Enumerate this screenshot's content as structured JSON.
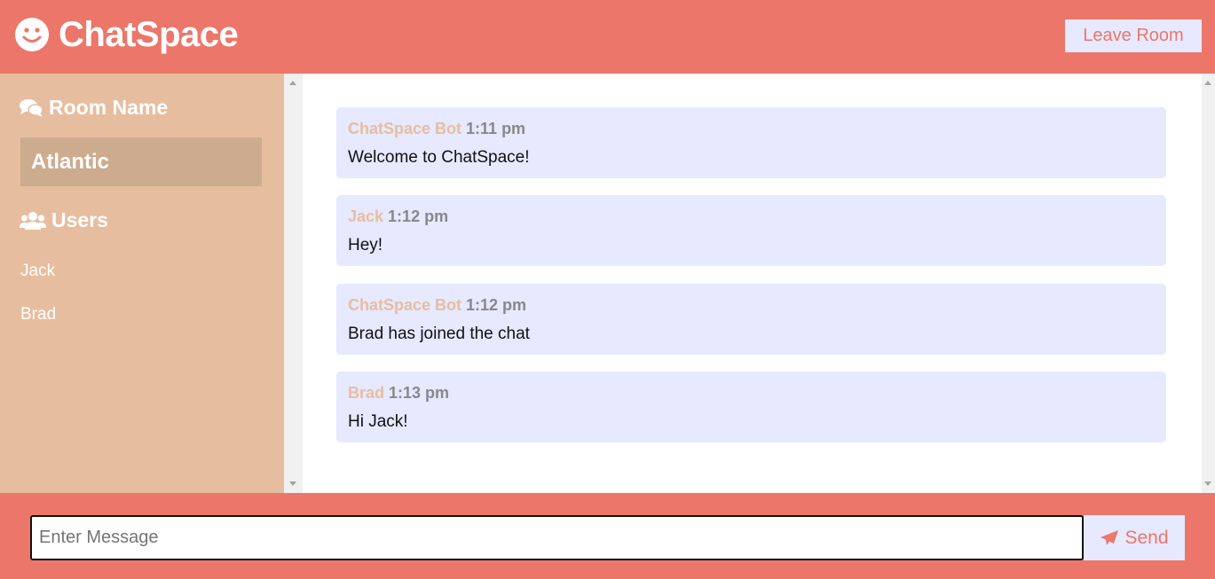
{
  "app": {
    "title": "ChatSpace",
    "leave_label": "Leave Room"
  },
  "sidebar": {
    "room_section_title": "Room Name",
    "room_name": "Atlantic",
    "users_section_title": "Users",
    "users": [
      "Jack",
      "Brad"
    ]
  },
  "messages": [
    {
      "author": "ChatSpace Bot",
      "time": "1:11 pm",
      "text": "Welcome to ChatSpace!"
    },
    {
      "author": "Jack",
      "time": "1:12 pm",
      "text": "Hey!"
    },
    {
      "author": "ChatSpace Bot",
      "time": "1:12 pm",
      "text": "Brad has joined the chat"
    },
    {
      "author": "Brad",
      "time": "1:13 pm",
      "text": "Hi Jack!"
    }
  ],
  "composer": {
    "placeholder": "Enter Message",
    "value": "",
    "send_label": "Send"
  },
  "icons": {
    "brand": "smile-icon",
    "room": "comments-icon",
    "users": "users-icon",
    "send": "paper-plane-icon"
  },
  "colors": {
    "primary": "#ec766a",
    "sidebar": "#e6be9f",
    "room_box": "#cdab8f",
    "message_bg": "#e6e9ff",
    "author": "#e6be9f"
  }
}
